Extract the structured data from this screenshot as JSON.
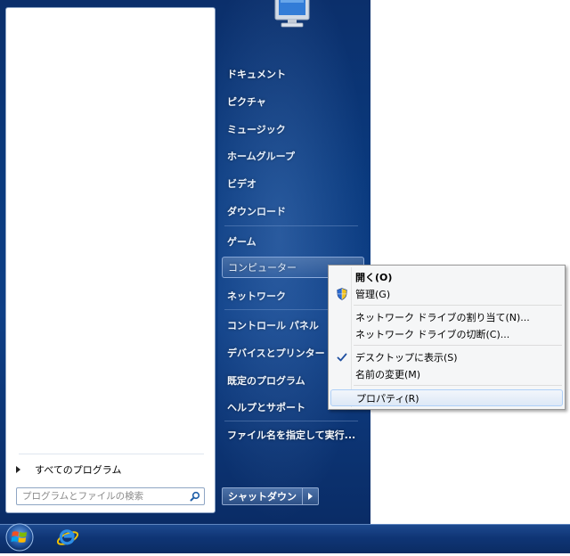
{
  "left_pane": {
    "all_programs_label": "すべてのプログラム",
    "search_placeholder": "プログラムとファイルの検索"
  },
  "right_pane": {
    "items": [
      {
        "label": "ドキュメント"
      },
      {
        "label": "ピクチャ"
      },
      {
        "label": "ミュージック"
      },
      {
        "label": "ホームグループ"
      },
      {
        "label": "ビデオ"
      },
      {
        "label": "ダウンロード"
      },
      {
        "label": "ゲーム"
      },
      {
        "label": "コンピューター"
      },
      {
        "label": "ネットワーク"
      },
      {
        "label": "コントロール パネル"
      },
      {
        "label": "デバイスとプリンター"
      },
      {
        "label": "既定のプログラム"
      },
      {
        "label": "ヘルプとサポート"
      },
      {
        "label": "ファイル名を指定して実行..."
      }
    ],
    "shutdown_label": "シャットダウン"
  },
  "context_menu": {
    "items": [
      {
        "label": "開く(O)"
      },
      {
        "label": "管理(G)"
      },
      {
        "label": "ネットワーク ドライブの割り当て(N)..."
      },
      {
        "label": "ネットワーク ドライブの切断(C)..."
      },
      {
        "label": "デスクトップに表示(S)"
      },
      {
        "label": "名前の変更(M)"
      },
      {
        "label": "プロパティ(R)"
      }
    ]
  },
  "icons": {
    "user_picture": "computer-monitor-icon",
    "start": "windows-orb-icon",
    "browser": "internet-explorer-icon",
    "search": "magnifier-icon",
    "shield": "uac-shield-icon",
    "check": "checkmark-icon"
  },
  "colors": {
    "menu_blue": "#0a3a7e",
    "taskbar_blue": "#0f3575",
    "context_bg": "#f5f6f7",
    "context_hover": "#dde8f6"
  }
}
